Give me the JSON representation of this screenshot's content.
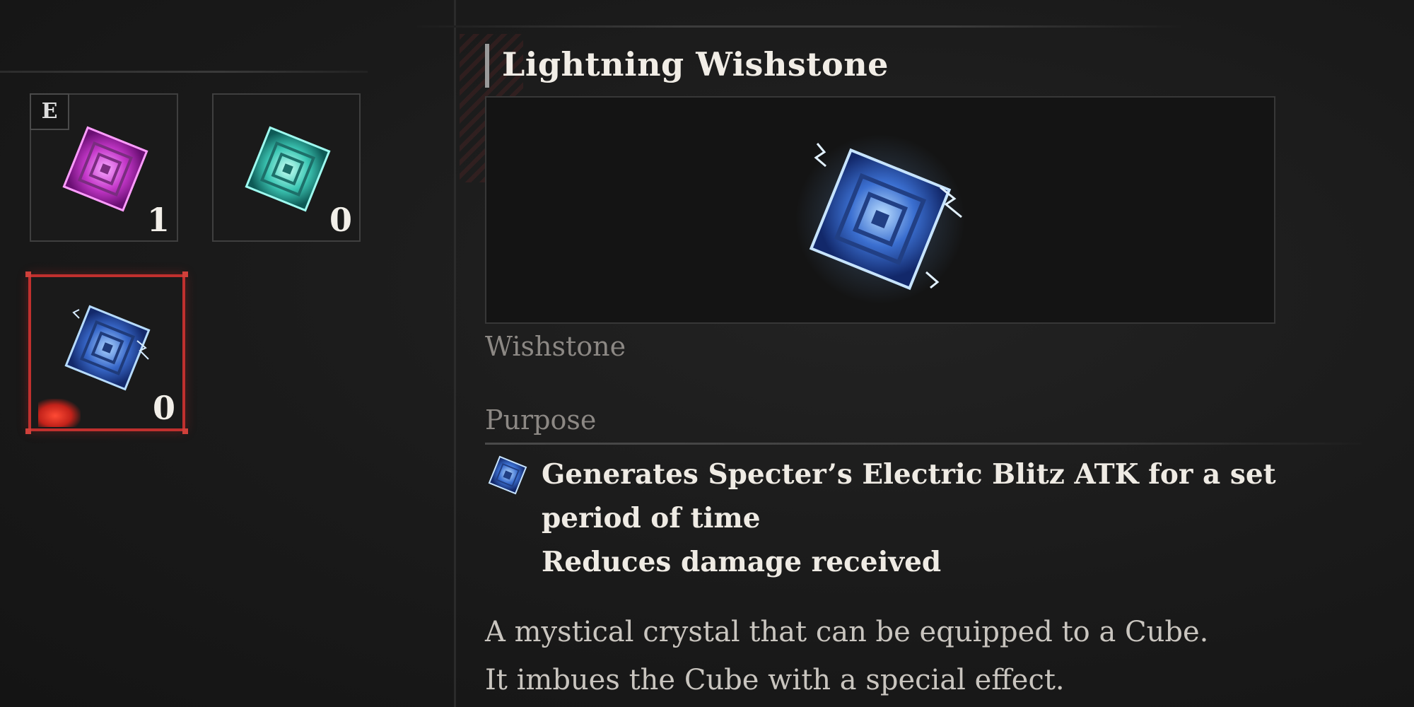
{
  "inventory": {
    "slots": [
      {
        "name": "Wishstone",
        "gem_color": "magenta",
        "count": "1",
        "equipped_badge": "E"
      },
      {
        "name": "Wishstone",
        "gem_color": "teal",
        "count": "0"
      },
      {
        "name": "Lightning Wishstone",
        "gem_color": "blue",
        "count": "0",
        "selected": true
      }
    ]
  },
  "detail": {
    "title": "Lightning Wishstone",
    "category": "Wishstone",
    "purpose_label": "Purpose",
    "effects": [
      "Generates Specter’s Electric Blitz ATK for a set",
      "period of time",
      "Reduces damage received"
    ],
    "description": [
      "A mystical crystal that can be equipped to a Cube.",
      "It imbues the Cube with a special effect."
    ]
  },
  "colors": {
    "selection_border": "#c0302e",
    "background": "#181818",
    "text_primary": "#efebe4",
    "text_muted": "#8c8884"
  },
  "icons": {
    "magenta_gem": "wishstone-magenta-icon",
    "teal_gem": "wishstone-teal-icon",
    "blue_gem": "lightning-wishstone-icon"
  }
}
